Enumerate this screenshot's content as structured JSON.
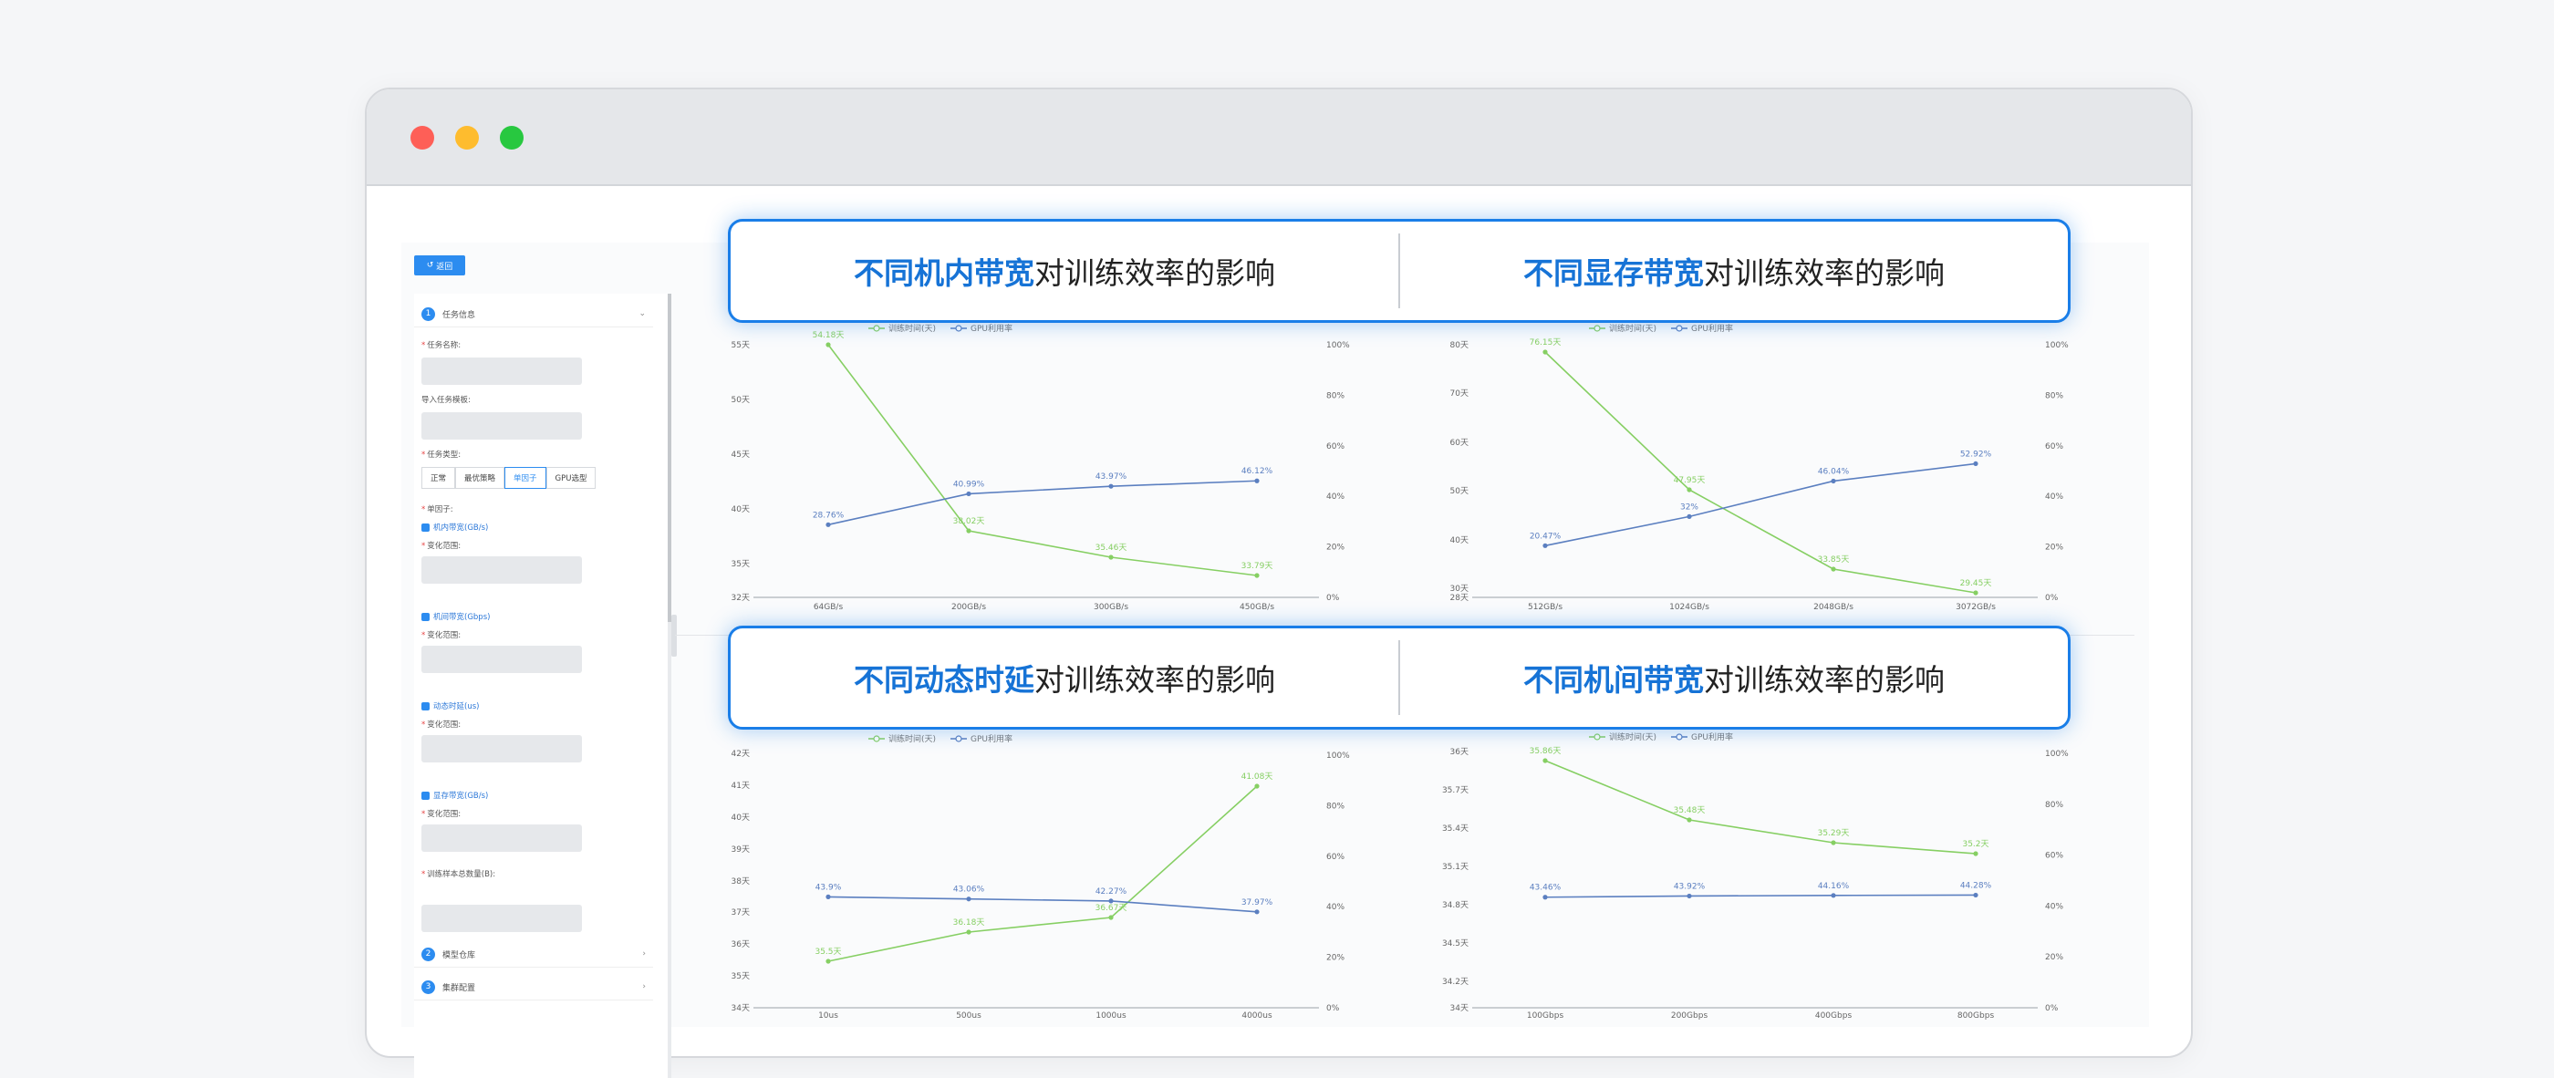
{
  "banners": {
    "top_left_bold": "不同机内带宽",
    "top_left_rest": "对训练效率的影响",
    "top_right_bold": "不同显存带宽",
    "top_right_rest": "对训练效率的影响",
    "bottom_left_bold": "不同动态时延",
    "bottom_left_rest": "对训练效率的影响",
    "bottom_right_bold": "不同机间带宽",
    "bottom_right_rest": "对训练效率的影响"
  },
  "toolbar": {
    "back_label": "返回"
  },
  "sidebar": {
    "section1": {
      "num": "1",
      "title": "任务信息"
    },
    "task_name_label": "任务名称:",
    "import_template_label": "导入任务模板:",
    "task_type_label": "任务类型:",
    "task_types": [
      "正常",
      "最优策略",
      "单因子",
      "GPU选型"
    ],
    "single_factor_label": "单因子:",
    "factors": [
      "机内带宽(GB/s)",
      "机间带宽(Gbps)",
      "动态时延(us)",
      "显存带宽(GB/s)"
    ],
    "range_label": "变化范围:",
    "train_samples_label": "训练样本总数量(B):",
    "section2": {
      "num": "2",
      "title": "模型仓库"
    },
    "section3": {
      "num": "3",
      "title": "集群配置"
    }
  },
  "legend": {
    "train_time": "训练时间(天)",
    "gpu_util": "GPU利用率"
  },
  "colors": {
    "train": "#86cf63",
    "gpu": "#5b7fc0",
    "accent": "#1a7ee8"
  },
  "chart_data": [
    {
      "type": "line",
      "x": [
        "64GB/s",
        "200GB/s",
        "300GB/s",
        "450GB/s"
      ],
      "series": [
        {
          "name": "训练时间(天)",
          "values": [
            54.18,
            38.02,
            35.46,
            33.79
          ],
          "labels": [
            "54.18天",
            "38.02天",
            "35.46天",
            "33.79天"
          ]
        },
        {
          "name": "GPU利用率",
          "values": [
            28.76,
            40.99,
            43.97,
            46.12
          ],
          "labels": [
            "28.76%",
            "40.99%",
            "43.97%",
            "46.12%"
          ]
        }
      ],
      "y_left_ticks": [
        "55天",
        "50天",
        "45天",
        "40天",
        "35天",
        "32天"
      ],
      "y_right_ticks": [
        "100%",
        "80%",
        "60%",
        "40%",
        "20%",
        "0%"
      ]
    },
    {
      "type": "line",
      "x": [
        "512GB/s",
        "1024GB/s",
        "2048GB/s",
        "3072GB/s"
      ],
      "series": [
        {
          "name": "训练时间(天)",
          "values": [
            76.15,
            47.95,
            33.85,
            29.45
          ],
          "labels": [
            "76.15天",
            "47.95天",
            "33.85天",
            "29.45天"
          ]
        },
        {
          "name": "GPU利用率",
          "values": [
            20.47,
            32.0,
            46.04,
            52.92
          ],
          "labels": [
            "20.47%",
            "32%",
            "46.04%",
            "52.92%"
          ]
        }
      ],
      "y_left_ticks": [
        "80天",
        "70天",
        "60天",
        "50天",
        "40天",
        "30天",
        "28天"
      ],
      "y_right_ticks": [
        "100%",
        "80%",
        "60%",
        "40%",
        "20%",
        "0%"
      ]
    },
    {
      "type": "line",
      "x": [
        "10us",
        "500us",
        "1000us",
        "4000us"
      ],
      "series": [
        {
          "name": "训练时间(天)",
          "values": [
            35.5,
            36.18,
            36.67,
            41.08
          ],
          "labels": [
            "35.5天",
            "36.18天",
            "36.67天",
            "41.08天"
          ]
        },
        {
          "name": "GPU利用率",
          "values": [
            43.9,
            43.06,
            42.27,
            37.97
          ],
          "labels": [
            "43.9%",
            "43.06%",
            "42.27%",
            "37.97%"
          ]
        }
      ],
      "y_left_ticks": [
        "42天",
        "41天",
        "40天",
        "39天",
        "38天",
        "37天",
        "36天",
        "35天",
        "34天"
      ],
      "y_right_ticks": [
        "100%",
        "80%",
        "60%",
        "40%",
        "20%",
        "0%"
      ]
    },
    {
      "type": "line",
      "x": [
        "100Gbps",
        "200Gbps",
        "400Gbps",
        "800Gbps"
      ],
      "series": [
        {
          "name": "训练时间(天)",
          "values": [
            35.86,
            35.48,
            35.29,
            35.2
          ],
          "labels": [
            "35.86天",
            "35.48天",
            "35.29天",
            "35.2天"
          ]
        },
        {
          "name": "GPU利用率",
          "values": [
            43.46,
            43.92,
            44.16,
            44.28
          ],
          "labels": [
            "43.46%",
            "43.92%",
            "44.16%",
            "44.28%"
          ]
        }
      ],
      "y_left_ticks": [
        "36天",
        "35.7天",
        "35.4天",
        "35.1天",
        "34.8天",
        "34.5天",
        "34.2天",
        "34天"
      ],
      "y_right_ticks": [
        "100%",
        "80%",
        "60%",
        "40%",
        "20%",
        "0%"
      ]
    }
  ]
}
